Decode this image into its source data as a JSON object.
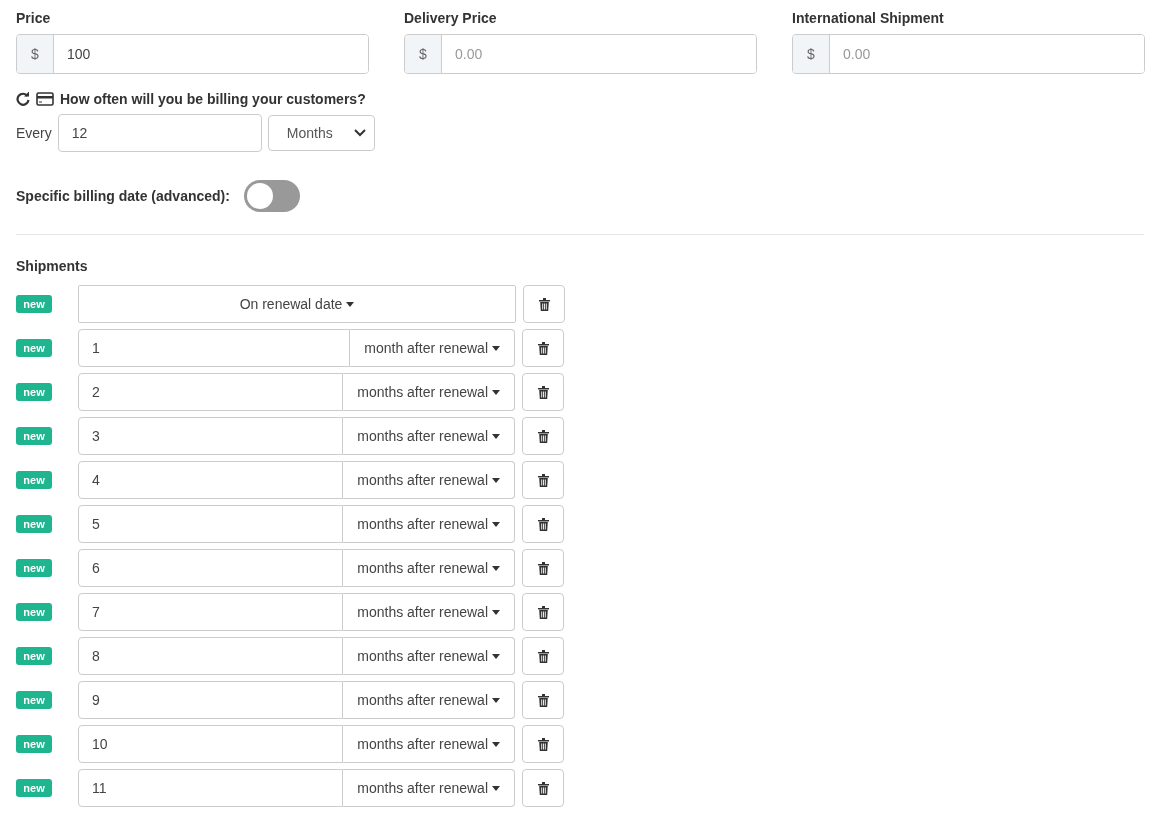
{
  "price_fields": [
    {
      "label": "Price",
      "prefix": "$",
      "value": "100"
    },
    {
      "label": "Delivery Price",
      "prefix": "$",
      "placeholder": "0.00"
    },
    {
      "label": "International Shipment",
      "prefix": "$",
      "placeholder": "0.00"
    }
  ],
  "billing": {
    "question": "How often will you be billing your customers?",
    "every_label": "Every",
    "every_value": "12",
    "unit": "Months"
  },
  "specific_date": {
    "label": "Specific billing date (advanced):",
    "on": false
  },
  "shipments": {
    "title": "Shipments",
    "rows": [
      {
        "kind": "renewal",
        "badge": "new",
        "option": "On renewal date"
      },
      {
        "kind": "offset",
        "badge": "new",
        "value": "1",
        "option": "month after renewal"
      },
      {
        "kind": "offset",
        "badge": "new",
        "value": "2",
        "option": "months after renewal"
      },
      {
        "kind": "offset",
        "badge": "new",
        "value": "3",
        "option": "months after renewal"
      },
      {
        "kind": "offset",
        "badge": "new",
        "value": "4",
        "option": "months after renewal"
      },
      {
        "kind": "offset",
        "badge": "new",
        "value": "5",
        "option": "months after renewal"
      },
      {
        "kind": "offset",
        "badge": "new",
        "value": "6",
        "option": "months after renewal"
      },
      {
        "kind": "offset",
        "badge": "new",
        "value": "7",
        "option": "months after renewal"
      },
      {
        "kind": "offset",
        "badge": "new",
        "value": "8",
        "option": "months after renewal"
      },
      {
        "kind": "offset",
        "badge": "new",
        "value": "9",
        "option": "months after renewal"
      },
      {
        "kind": "offset",
        "badge": "new",
        "value": "10",
        "option": "months after renewal"
      },
      {
        "kind": "offset",
        "badge": "new",
        "value": "11",
        "option": "months after renewal"
      }
    ]
  }
}
